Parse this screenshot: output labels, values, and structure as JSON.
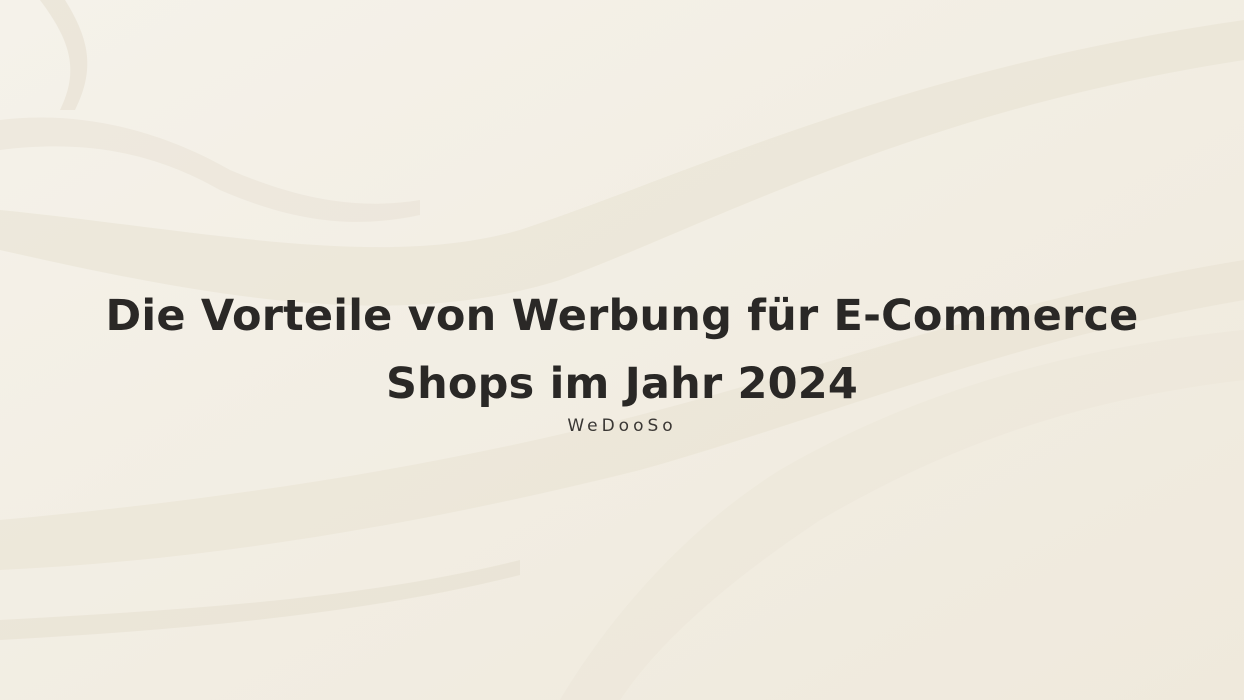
{
  "title_line_1": "Die Vorteile von Werbung für E-Commerce",
  "title_line_2": "Shops im Jahr 2024",
  "brand": "WeDooSo",
  "colors": {
    "background": "#f3efe5",
    "text": "#2a2826"
  }
}
